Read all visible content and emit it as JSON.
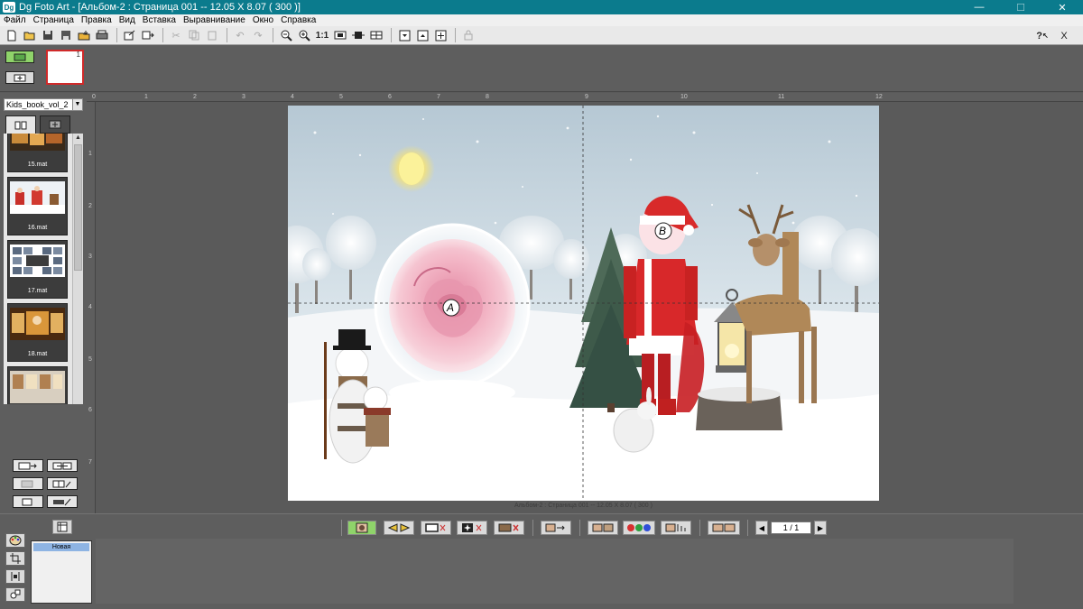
{
  "window": {
    "title": "Dg Foto Art - [Альбом-2 : Страница 001 -- 12.05 X 8.07 ( 300 )]",
    "app_icon_text": "Dg",
    "minimize": "—",
    "maximize": "☐",
    "close": "✕"
  },
  "menu": [
    "Файл",
    "Страница",
    "Правка",
    "Вид",
    "Вставка",
    "Выравнивание",
    "Окно",
    "Справка"
  ],
  "toolbar": {
    "zoom_1to1": "1:1",
    "help": "?",
    "help_cursor": "↖",
    "close_doc": "X"
  },
  "page_strip": {
    "pages": [
      {
        "number": "1"
      }
    ]
  },
  "album_panel": {
    "selected_album": "Kids_book_vol_2",
    "thumbnails": [
      {
        "label": "15.mat"
      },
      {
        "label": "16.mat"
      },
      {
        "label": "17.mat"
      },
      {
        "label": "18.mat"
      },
      {
        "label": ""
      }
    ]
  },
  "ruler": {
    "top": [
      "0",
      "1",
      "2",
      "3",
      "4",
      "5",
      "6",
      "7",
      "8",
      "9",
      "10",
      "11",
      "12"
    ],
    "left": [
      "1",
      "2",
      "3",
      "4",
      "5",
      "6",
      "7"
    ]
  },
  "canvas": {
    "frame_a_label": "A",
    "frame_b_label": "B",
    "caption": "Альбом-2 : Страница 001 -- 12.05 X 8.07 ( 300 )"
  },
  "bottom_toolbar": {
    "page_counter": "1 / 1"
  },
  "styles_panel": {
    "items": [
      {
        "label": "Новая"
      }
    ]
  },
  "colors": {
    "titlebar": "#0b7b8d",
    "workspace": "#5a5a5a",
    "selection": "#d02a2a",
    "active_tool": "#8fd46a",
    "style_selected": "#8eb4e3"
  }
}
